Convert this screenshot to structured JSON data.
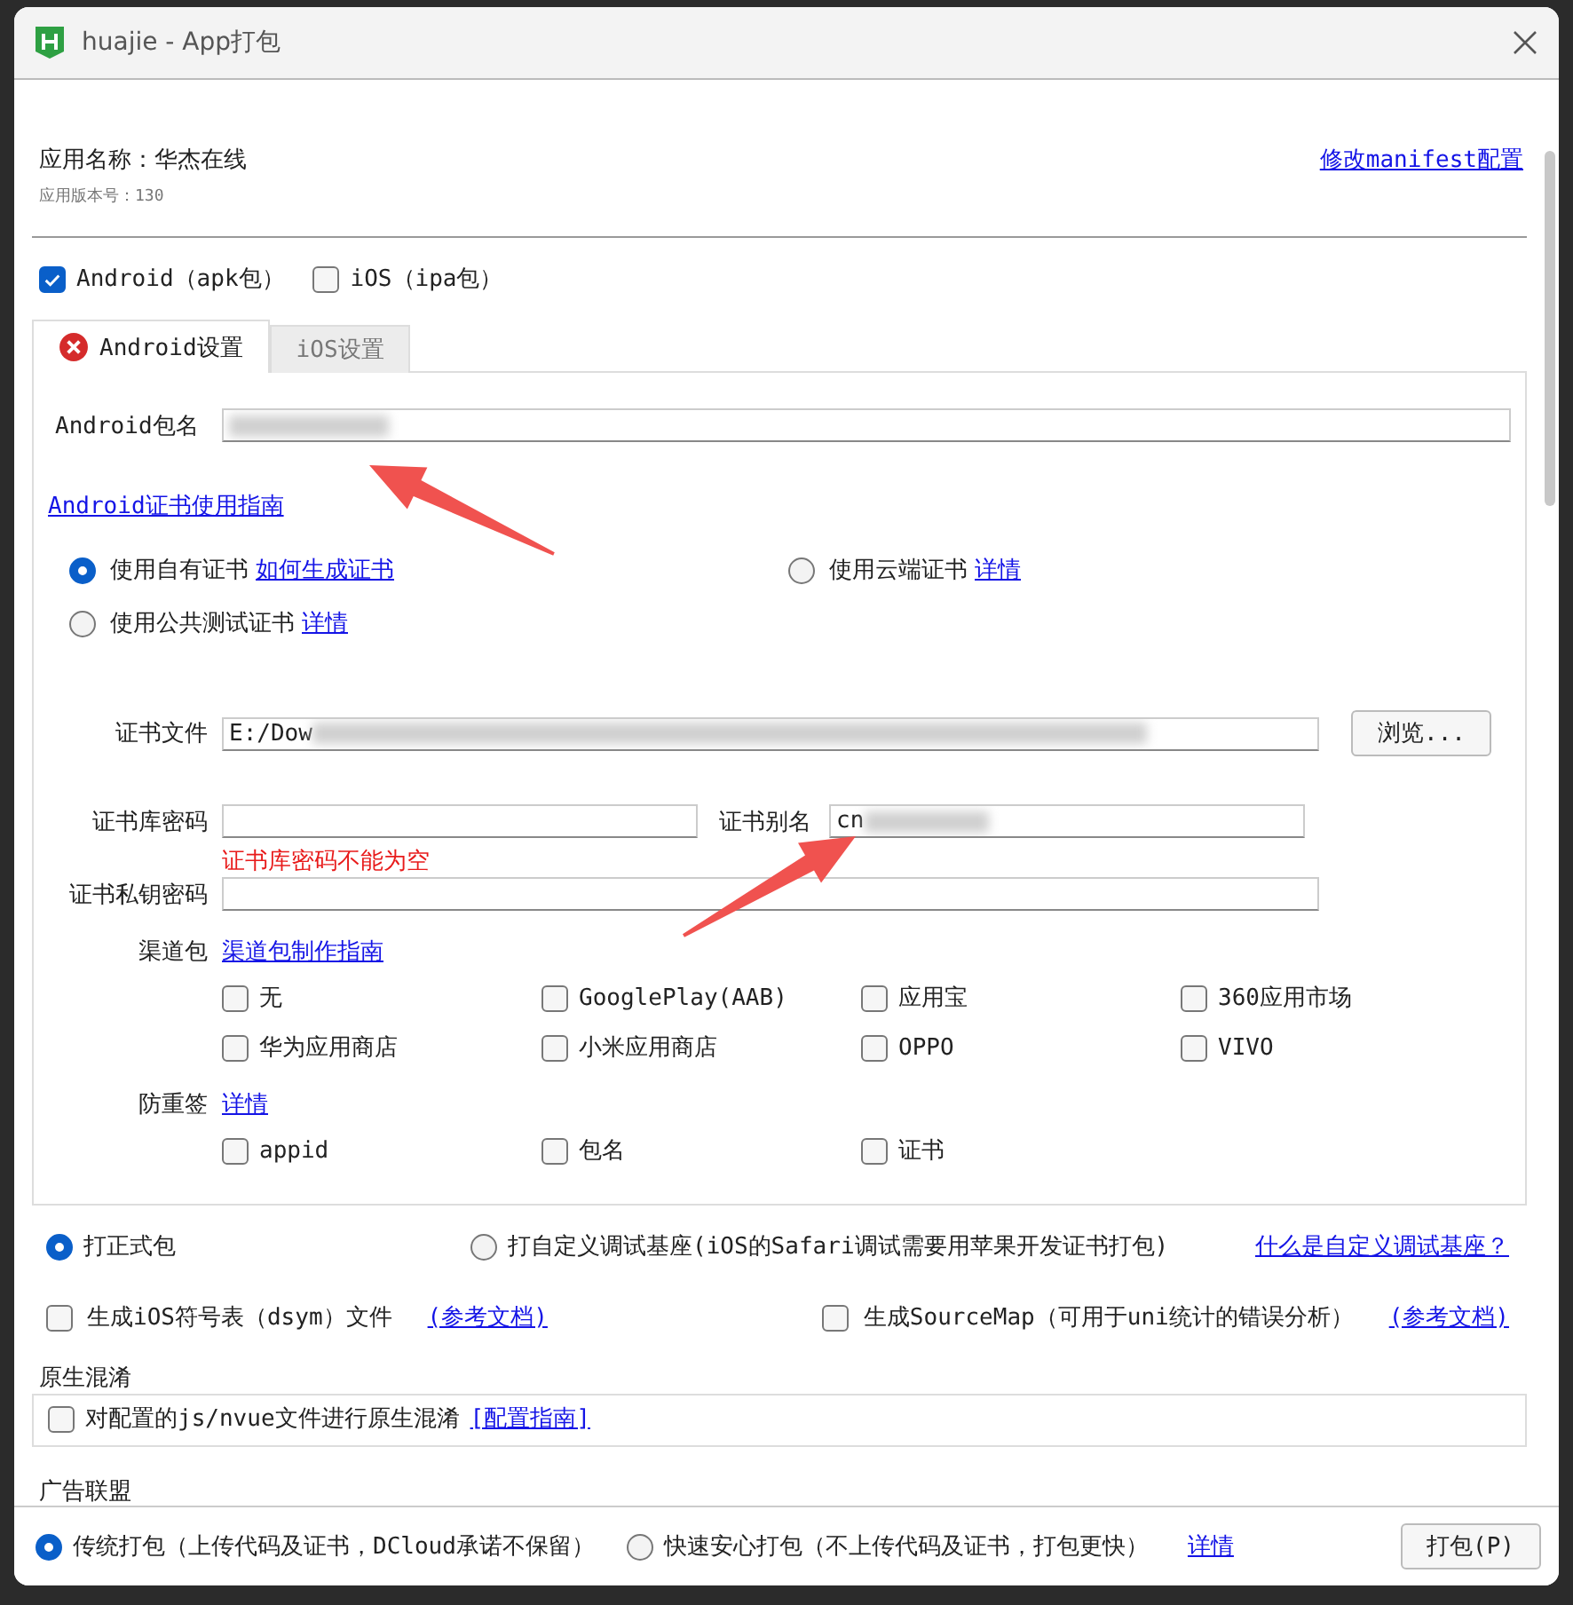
{
  "window": {
    "title": "huajie - App打包"
  },
  "app": {
    "name": "应用名称：华杰在线",
    "version": "应用版本号：130",
    "manifest_link": "修改manifest配置"
  },
  "platforms": [
    {
      "label": "Android（apk包）",
      "checked": true
    },
    {
      "label": "iOS（ipa包）",
      "checked": false
    }
  ],
  "tabs": [
    {
      "label": "Android设置",
      "selected": true,
      "error": true
    },
    {
      "label": "iOS设置",
      "selected": false,
      "error": false
    }
  ],
  "package_name": {
    "label": "Android包名",
    "redacted": true
  },
  "cert_guide_link": "Android证书使用指南",
  "cert_options": [
    {
      "label": "使用自有证书",
      "link": "如何生成证书",
      "selected": true
    },
    {
      "label": "使用云端证书",
      "link": "详情",
      "selected": false
    },
    {
      "label": "使用公共测试证书",
      "link": "详情",
      "selected": false
    }
  ],
  "cert_file": {
    "label": "证书文件",
    "value": "E:/Dow",
    "redacted": true,
    "button": "浏览..."
  },
  "keystore_password": {
    "label": "证书库密码",
    "error": "证书库密码不能为空"
  },
  "alias": {
    "label": "证书别名",
    "value": "cn",
    "redacted": true
  },
  "key_password": {
    "label": "证书私钥密码"
  },
  "channels": {
    "label": "渠道包",
    "link": "渠道包制作指南",
    "items": [
      {
        "label": "无",
        "checked": false
      },
      {
        "label": "GooglePlay(AAB)",
        "checked": false
      },
      {
        "label": "应用宝",
        "checked": false
      },
      {
        "label": "360应用市场",
        "checked": false
      },
      {
        "label": "华为应用商店",
        "checked": false
      },
      {
        "label": "小米应用商店",
        "checked": false
      },
      {
        "label": "OPPO",
        "checked": false
      },
      {
        "label": "VIVO",
        "checked": false
      }
    ]
  },
  "anti_resign": {
    "label": "防重签",
    "link": "详情",
    "items": [
      {
        "label": "appid",
        "checked": false
      },
      {
        "label": "包名",
        "checked": false
      },
      {
        "label": "证书",
        "checked": false
      }
    ]
  },
  "build_modes": [
    {
      "label": "打正式包",
      "selected": true
    },
    {
      "label": "打自定义调试基座(iOS的Safari调试需要用苹果开发证书打包)",
      "selected": false
    }
  ],
  "debug_link": "什么是自定义调试基座？",
  "options": [
    {
      "label": "生成iOS符号表（dsym）文件",
      "link": "(参考文档)",
      "checked": false
    },
    {
      "label": "生成SourceMap（可用于uni统计的错误分析）",
      "link": "(参考文档)",
      "checked": false
    }
  ],
  "obfuscation": {
    "title": "原生混淆",
    "label": "对配置的js/nvue文件进行原生混淆",
    "link": "[配置指南]",
    "checked": false
  },
  "ads": {
    "title": "广告联盟"
  },
  "footer": {
    "modes": [
      {
        "label": "传统打包（上传代码及证书，DCloud承诺不保留）",
        "selected": true
      },
      {
        "label": "快速安心打包（不上传代码及证书，打包更快）",
        "selected": false
      }
    ],
    "link": "详情",
    "button": "打包(P)"
  }
}
